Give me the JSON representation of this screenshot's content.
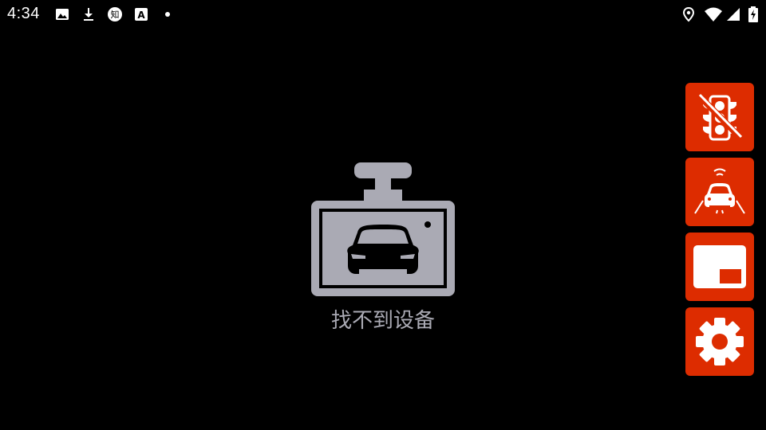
{
  "status_bar": {
    "time": "4:34",
    "left_icons": [
      "image-icon",
      "download-icon",
      "zhihu-icon",
      "a-icon",
      "dot-icon"
    ],
    "right_icons": [
      "location-icon",
      "wifi-icon",
      "cell-signal-icon",
      "battery-charging-icon"
    ]
  },
  "main": {
    "empty_icon": "dashcam-car-icon",
    "message": "找不到设备",
    "icon_color": "#aaaab4"
  },
  "side_buttons": [
    {
      "name": "traffic-light-off-button",
      "icon": "traffic-light-off-icon"
    },
    {
      "name": "lane-car-button",
      "icon": "car-lane-icon"
    },
    {
      "name": "picture-in-picture-button",
      "icon": "picture-in-picture-icon"
    },
    {
      "name": "settings-button",
      "icon": "gear-icon"
    }
  ],
  "accent_color": "#dd2c00"
}
